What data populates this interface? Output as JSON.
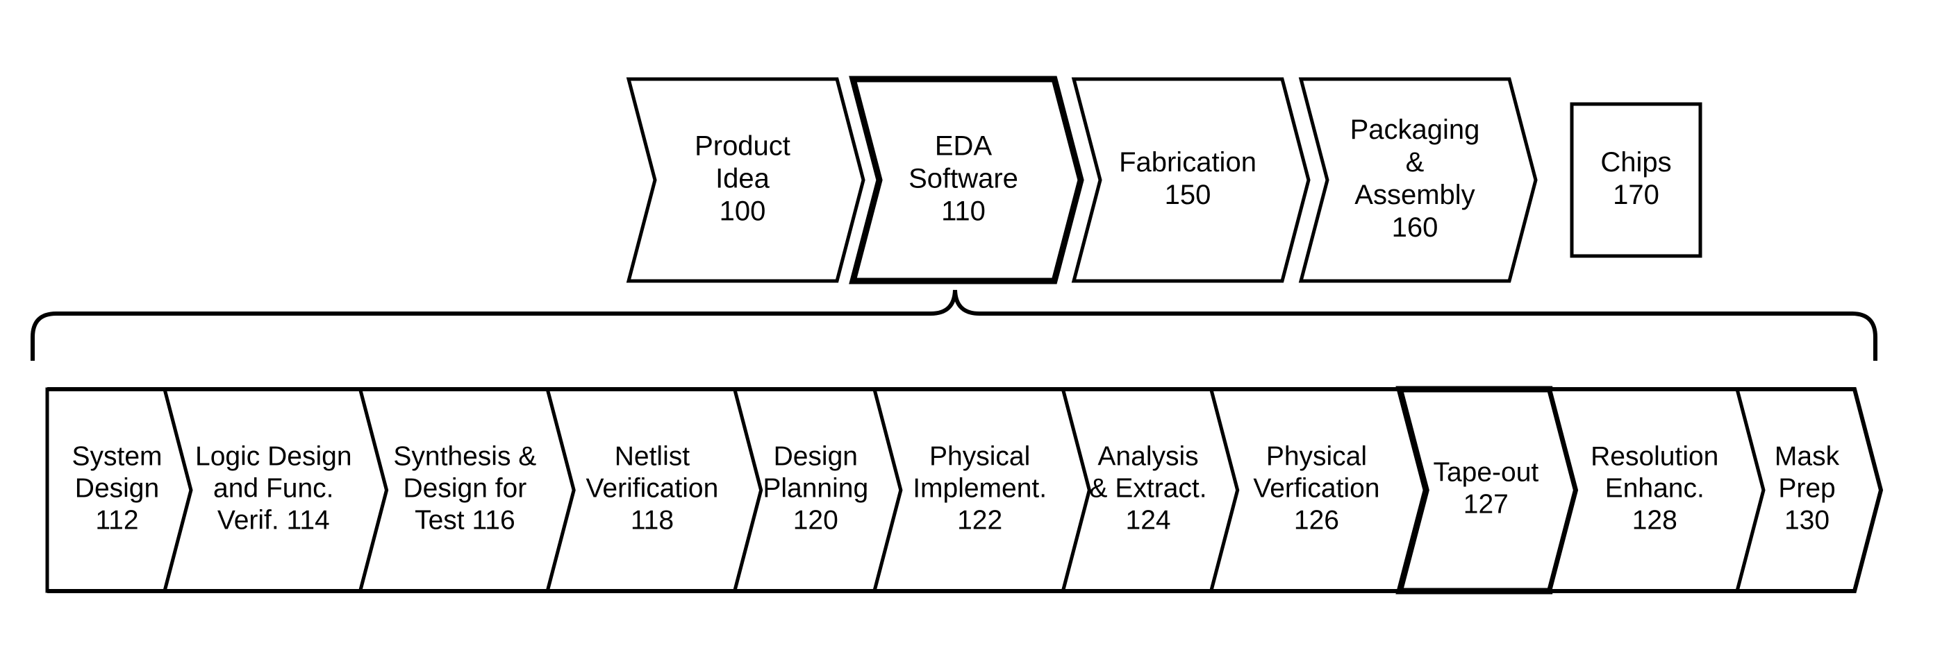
{
  "figure": {
    "type": "patent-flow-diagram",
    "title": "EDA design flow",
    "colors": {
      "background": "#ffffff",
      "stroke": "#000000",
      "fill": "#ffffff"
    }
  },
  "top_flow": {
    "shape": "chevron",
    "steps": [
      {
        "id": "product-idea",
        "lines": [
          "Product",
          "Idea",
          "100"
        ],
        "ref": "100",
        "emphasis": false,
        "shape": "chevron"
      },
      {
        "id": "eda-software",
        "lines": [
          "EDA",
          "Software",
          "110"
        ],
        "ref": "110",
        "emphasis": true,
        "shape": "chevron"
      },
      {
        "id": "fabrication",
        "lines": [
          "Fabrication",
          "150"
        ],
        "ref": "150",
        "emphasis": false,
        "shape": "chevron"
      },
      {
        "id": "packaging-assembly",
        "lines": [
          "Packaging",
          "&",
          "Assembly",
          "160"
        ],
        "ref": "160",
        "emphasis": false,
        "shape": "chevron"
      },
      {
        "id": "chips",
        "lines": [
          "Chips",
          "170"
        ],
        "ref": "170",
        "emphasis": false,
        "shape": "rectangle"
      }
    ]
  },
  "connector": {
    "id": "eda-expansion-brace",
    "kind": "horizontal-curly-brace",
    "points_from": "eda-software",
    "points_to": "detail_flow"
  },
  "detail_flow": {
    "shape": "chevron-strip",
    "steps": [
      {
        "id": "system-design",
        "lines": [
          "System",
          "Design",
          "112"
        ],
        "ref": "112",
        "emphasis": false
      },
      {
        "id": "logic-design-and-func-verif",
        "lines": [
          "Logic Design",
          "and Func.",
          "Verif. 114"
        ],
        "ref": "114",
        "emphasis": false
      },
      {
        "id": "synthesis-and-design-for-test",
        "lines": [
          "Synthesis &",
          "Design for",
          "Test 116"
        ],
        "ref": "116",
        "emphasis": false
      },
      {
        "id": "netlist-verification",
        "lines": [
          "Netlist",
          "Verification",
          "118"
        ],
        "ref": "118",
        "emphasis": false
      },
      {
        "id": "design-planning",
        "lines": [
          "Design",
          "Planning",
          "120"
        ],
        "ref": "120",
        "emphasis": false
      },
      {
        "id": "physical-implementation",
        "lines": [
          "Physical",
          "Implement.",
          "122"
        ],
        "ref": "122",
        "emphasis": false
      },
      {
        "id": "analysis-and-extraction",
        "lines": [
          "Analysis",
          "& Extract.",
          "124"
        ],
        "ref": "124",
        "emphasis": false
      },
      {
        "id": "physical-verification",
        "lines": [
          "Physical",
          "Verfication",
          "126"
        ],
        "ref": "126",
        "emphasis": false
      },
      {
        "id": "tape-out",
        "lines": [
          "Tape-out",
          "127"
        ],
        "ref": "127",
        "emphasis": true
      },
      {
        "id": "resolution-enhancement",
        "lines": [
          "Resolution",
          "Enhanc.",
          "128"
        ],
        "ref": "128",
        "emphasis": false
      },
      {
        "id": "mask-prep",
        "lines": [
          "Mask",
          "Prep",
          "130"
        ],
        "ref": "130",
        "emphasis": false
      }
    ]
  }
}
